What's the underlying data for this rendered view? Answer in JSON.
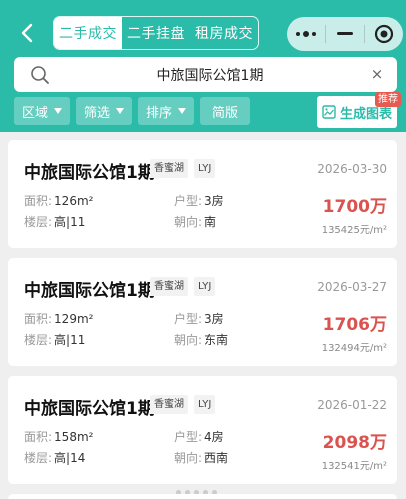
{
  "header": {
    "tabs": [
      {
        "label": "二手成交",
        "active": true
      },
      {
        "label": "二手挂盘",
        "active": false
      },
      {
        "label": "租房成交",
        "active": false
      }
    ],
    "icons": {
      "back": "chevron-left-icon",
      "more": "more-dots-icon",
      "minimize": "minimize-icon",
      "close": "target-close-icon"
    }
  },
  "search": {
    "value": "中旅国际公馆1期",
    "clear": "×"
  },
  "filters": [
    {
      "label": "区域",
      "has_arrow": true
    },
    {
      "label": "筛选",
      "has_arrow": true
    },
    {
      "label": "排序",
      "has_arrow": true
    },
    {
      "label": "简版",
      "has_arrow": false
    }
  ],
  "generate": {
    "label": "生成图表",
    "badge": "推荐"
  },
  "colors": {
    "brand": "#2bbba9",
    "price": "#d9534f",
    "badge": "#e85a4f"
  },
  "listings": [
    {
      "name": "中旅国际公馆1期",
      "district": "香蜜湖",
      "code": "LYJ",
      "date": "2026-03-30",
      "area_label": "面积:",
      "area": "126m²",
      "layout_label": "户型:",
      "layout": "3房",
      "floor_label": "楼层:",
      "floor": "高|11",
      "facing_label": "朝向:",
      "facing": "南",
      "price": "1700万",
      "unit_price": "135425元/m²"
    },
    {
      "name": "中旅国际公馆1期",
      "district": "香蜜湖",
      "code": "LYJ",
      "date": "2026-03-27",
      "area_label": "面积:",
      "area": "129m²",
      "layout_label": "户型:",
      "layout": "3房",
      "floor_label": "楼层:",
      "floor": "高|11",
      "facing_label": "朝向:",
      "facing": "东南",
      "price": "1706万",
      "unit_price": "132494元/m²"
    },
    {
      "name": "中旅国际公馆1期",
      "district": "香蜜湖",
      "code": "LYJ",
      "date": "2026-01-22",
      "area_label": "面积:",
      "area": "158m²",
      "layout_label": "户型:",
      "layout": "4房",
      "floor_label": "楼层:",
      "floor": "高|14",
      "facing_label": "朝向:",
      "facing": "西南",
      "price": "2098万",
      "unit_price": "132541元/m²"
    }
  ]
}
